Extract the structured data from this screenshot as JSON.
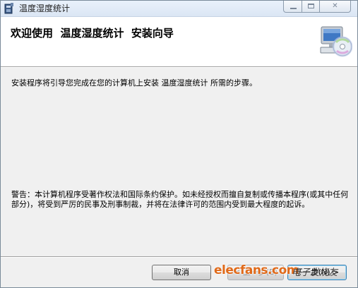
{
  "window": {
    "title": "温度湿度统计",
    "icon": "installer-icon"
  },
  "titlebar_buttons": {
    "minimize": "minimize-icon",
    "maximize": "maximize-icon",
    "close_label": "✕"
  },
  "banner": {
    "title": "欢迎使用  温度湿度统计  安装向导",
    "icon": "computer-disc-icon"
  },
  "content": {
    "intro": "安装程序将引导您完成在您的计算机上安装 温度湿度统计 所需的步骤。",
    "warning": "警告：本计算机程序受著作权法和国际条约保护。如未经授权而擅自复制或传播本程序(或其中任何部分)，将受到严厉的民事及刑事制裁，并将在法律许可的范围内受到最大程度的起诉。"
  },
  "buttons": {
    "cancel": "取消",
    "back": "< 上一步(B)",
    "next": "下一步(N) >"
  },
  "watermark": {
    "text": "elecfans.com",
    "subtext": "电子发烧友",
    "color": "#e06a1a"
  }
}
